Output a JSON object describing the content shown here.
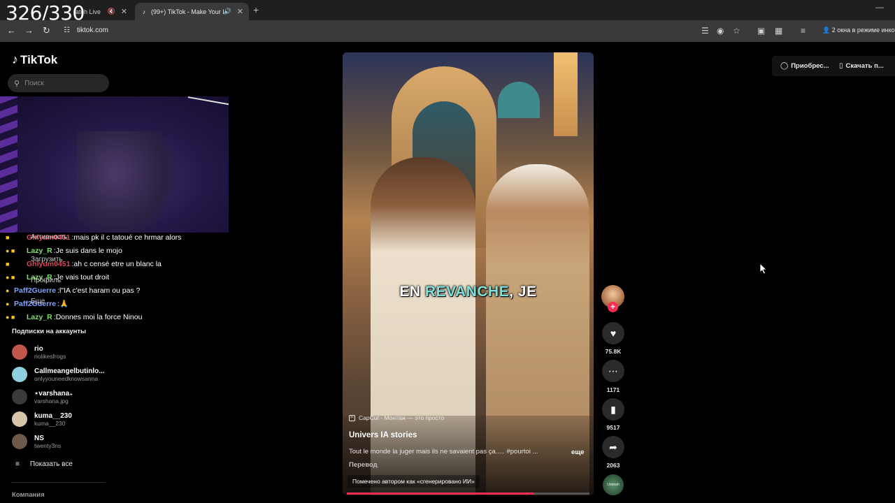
{
  "overlay_counter": "326/330",
  "browser": {
    "tabs": [
      {
        "label": "atch Live",
        "icon": "mute-icon"
      },
      {
        "label": "(99+) TikTok - Make Your Da",
        "icon": "tiktok-icon"
      }
    ],
    "url": "tiktok.com",
    "incognito_label": "2 окна в режиме инког"
  },
  "sidebar": {
    "logo": "TikTok",
    "search_placeholder": "Поиск",
    "menu_overlay": [
      "Активность",
      "Загрузить",
      "Профиль",
      "Еще"
    ],
    "subs_title": "Подписки на аккаунты",
    "subscriptions": [
      {
        "name": "rio",
        "handle": "riolikesfrogs",
        "color": "#c2564c"
      },
      {
        "name": "Callmeangelbutinlo...",
        "handle": "onlyyouneedknowsanna",
        "color": "#8fd0e0"
      },
      {
        "name": "⋆varshana₊",
        "handle": "varshana.jpg",
        "color": "#3a3a3a"
      },
      {
        "name": "kuma__230",
        "handle": "kuma__230",
        "color": "#d8c4a8"
      },
      {
        "name": "NS",
        "handle": "twenty3ns",
        "color": "#6b5a4a"
      }
    ],
    "show_all": "Показать все",
    "company": "Компания"
  },
  "chat": [
    {
      "user": "Ghlyum0451",
      "msg": "mais pk il c tatoué ce hrmar alors",
      "color": "red"
    },
    {
      "user": "Lazy_R",
      "msg": "Je suis dans le mojo",
      "color": "green"
    },
    {
      "user": "Ghlyum0451",
      "msg": "ah c censé etre un blanc la",
      "color": "red"
    },
    {
      "user": "Lazy_R",
      "msg": "Je vais tout droit",
      "color": "green"
    },
    {
      "user": "Paff2Guerre",
      "msg": "l\"IA c'est haram ou pas ?",
      "color": "blue"
    },
    {
      "user": "Paff2Guerre",
      "msg": "🙏",
      "color": "blue"
    },
    {
      "user": "Lazy_R",
      "msg": "Donnes moi la force Ninou",
      "color": "green"
    }
  ],
  "video": {
    "caption_plain": "EN ",
    "caption_highlight": "REVANCHE",
    "caption_rest": ", JE",
    "capcut": "CapCut - Монтаж — это просто",
    "author": "Univers IA stories",
    "description": "Tout le monde la juger mais ils ne savaient pas ça..... #pourtoi ...",
    "more": "еще",
    "translate": "Перевод",
    "ai_tag": "Помечено автором как «сгенерировано ИИ»",
    "progress": 0.77
  },
  "actions": {
    "likes": "75.8K",
    "comments": "1171",
    "saves": "9517",
    "shares": "2063",
    "disc_label": "Ummah"
  },
  "top_buttons": {
    "buy": "Приобрес...",
    "download": "Скачать п..."
  }
}
